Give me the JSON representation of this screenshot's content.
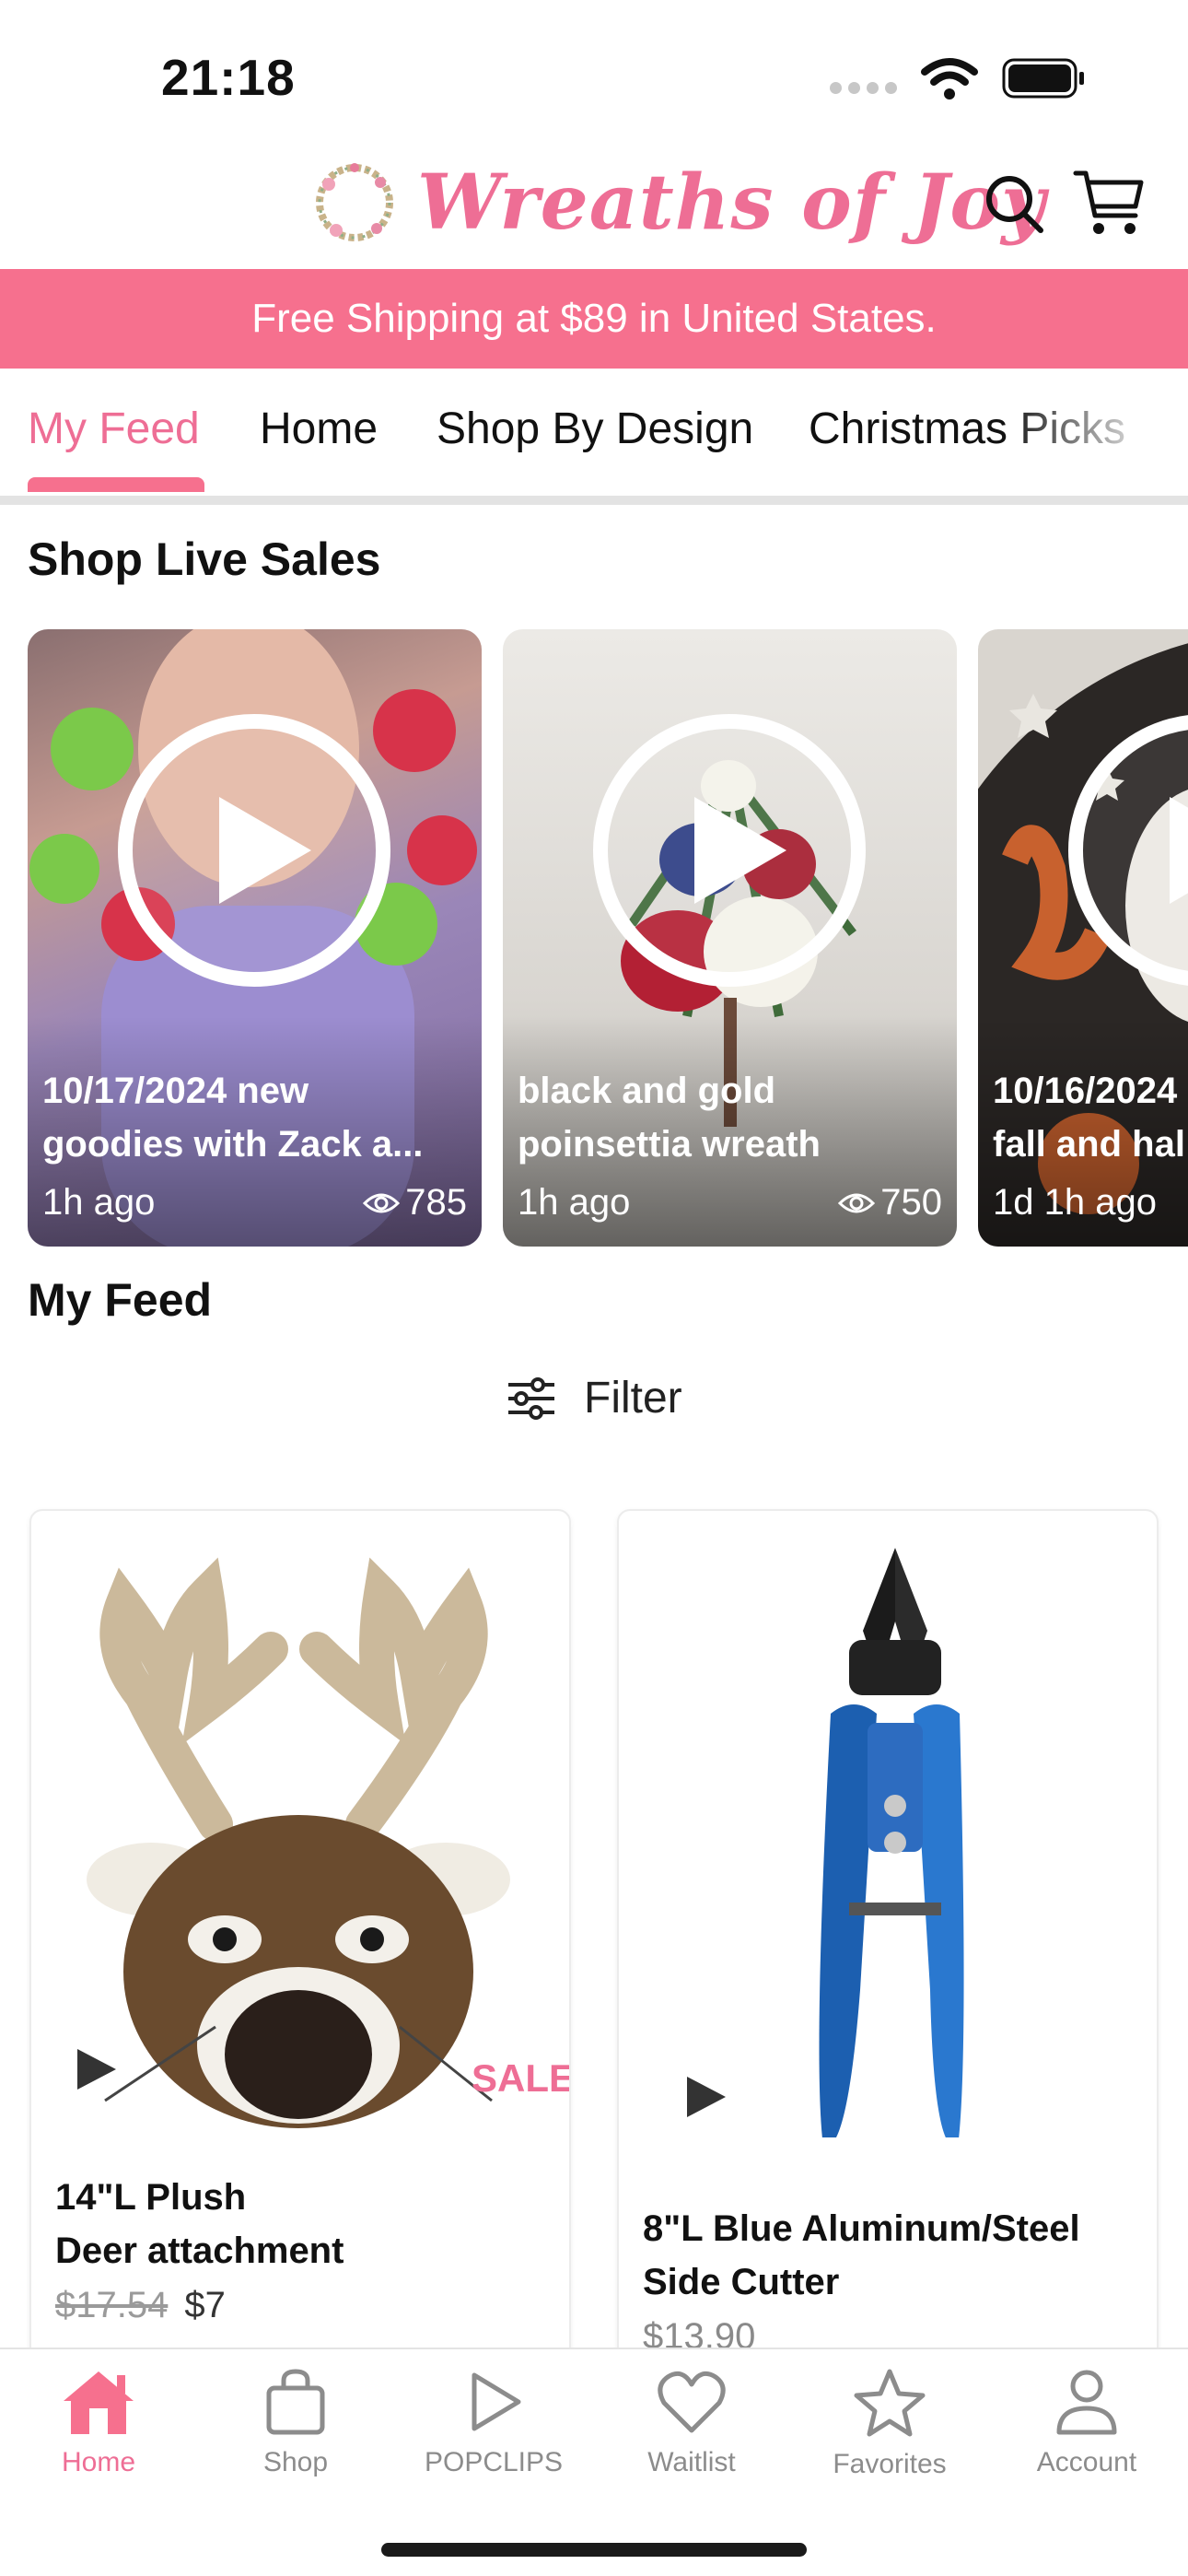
{
  "status_bar": {
    "time": "21:18"
  },
  "header": {
    "brand": "Wreaths of Joy",
    "search_icon": "search-icon",
    "cart_icon": "cart-icon"
  },
  "banner": {
    "text": "Free Shipping at $89 in United States."
  },
  "tabs": [
    {
      "label": "My Feed",
      "active": true
    },
    {
      "label": "Home"
    },
    {
      "label": "Shop By Design"
    },
    {
      "label": "Christmas Picks"
    }
  ],
  "live_section": {
    "title": "Shop Live Sales",
    "cards": [
      {
        "title": "10/17/2024 new\ngoodies with Zack a...",
        "time": "1h ago",
        "views": "785"
      },
      {
        "title": "black and gold\npoinsettia wreath",
        "time": "1h ago",
        "views": "750"
      },
      {
        "title": "10/16/2024\nfall and hal",
        "time": "1d 1h ago",
        "views": ""
      }
    ]
  },
  "feed_section": {
    "title": "My Feed",
    "filter_label": "Filter",
    "products": [
      {
        "title": "14\"L Plush\nDeer attachment",
        "old_price": "$17.54",
        "price": "$7",
        "sale_label": "SALE"
      },
      {
        "title": "8\"L Blue Aluminum/Steel\nSide Cutter",
        "old_price": "",
        "price": "$13.90"
      }
    ]
  },
  "bottom_nav": [
    {
      "label": "Home",
      "icon": "home-icon",
      "active": true
    },
    {
      "label": "Shop",
      "icon": "bag-icon"
    },
    {
      "label": "POPCLIPS",
      "icon": "play-icon"
    },
    {
      "label": "Waitlist",
      "icon": "heart-icon"
    },
    {
      "label": "Favorites",
      "icon": "star-icon"
    },
    {
      "label": "Account",
      "icon": "person-icon"
    }
  ],
  "colors": {
    "accent": "#ee6e95",
    "banner": "#f6708e"
  }
}
